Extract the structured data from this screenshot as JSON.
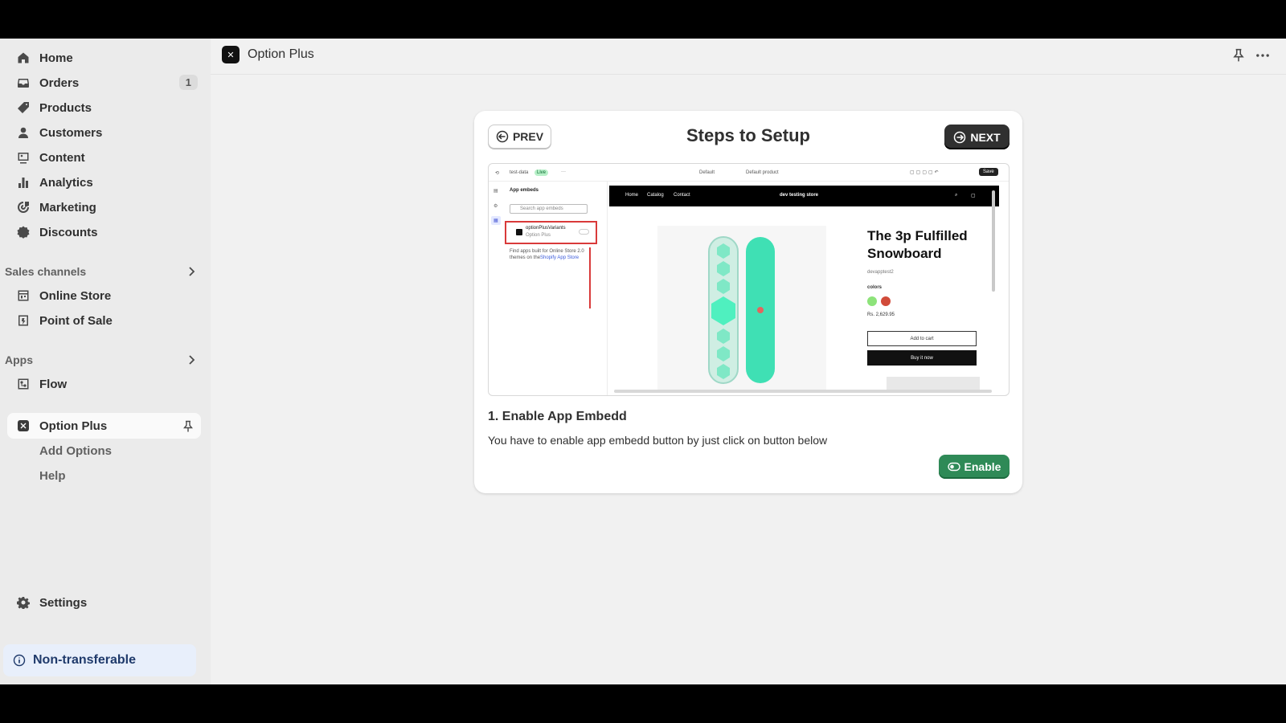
{
  "sidebar": {
    "items": [
      {
        "label": "Home",
        "icon": "home-icon"
      },
      {
        "label": "Orders",
        "icon": "inbox-icon",
        "badge": "1"
      },
      {
        "label": "Products",
        "icon": "tag-icon"
      },
      {
        "label": "Customers",
        "icon": "person-icon"
      },
      {
        "label": "Content",
        "icon": "image-icon"
      },
      {
        "label": "Analytics",
        "icon": "bar-chart-icon"
      },
      {
        "label": "Marketing",
        "icon": "target-icon"
      },
      {
        "label": "Discounts",
        "icon": "discount-icon"
      }
    ],
    "sales_channels_label": "Sales channels",
    "sales_channels": [
      {
        "label": "Online Store",
        "icon": "store-icon"
      },
      {
        "label": "Point of Sale",
        "icon": "pos-icon"
      }
    ],
    "apps_label": "Apps",
    "apps": [
      {
        "label": "Flow",
        "icon": "flow-icon"
      }
    ],
    "active_app": {
      "label": "Option Plus",
      "sub_items": [
        "Add Options",
        "Help"
      ]
    },
    "settings_label": "Settings",
    "non_transferable_label": "Non-transferable"
  },
  "topbar": {
    "app_title": "Option Plus"
  },
  "card": {
    "title": "Steps to Setup",
    "prev_label": "PREV",
    "next_label": "NEXT",
    "step_title": "1. Enable App Embedd",
    "step_description": "You have to enable app embedd button by just click on button below",
    "enable_label": "Enable"
  },
  "preview": {
    "theme_name": "test-data",
    "live_badge": "Live",
    "default_label": "Default",
    "default_product_label": "Default product",
    "save_label": "Save",
    "app_embeds_label": "App embeds",
    "search_placeholder": "Search app embeds",
    "embed_name": "optionPlusVariants",
    "embed_app": "Option Plus",
    "find_apps_text": "Find apps built for Online Store 2.0",
    "find_apps_text2": "themes on the",
    "app_store_link": "Shopify App Store",
    "nav": [
      "Home",
      "Catalog",
      "Contact"
    ],
    "store_name": "dev testing store",
    "product_title": "The 3p Fulfilled Snowboard",
    "vendor": "devapptest2",
    "colors_label": "colors",
    "price": "Rs. 2,629.95",
    "add_to_cart": "Add to cart",
    "buy_now": "Buy it now"
  },
  "colors": {
    "accent_green": "#2f8a57",
    "dark_button": "#303030",
    "highlight_red": "#d93a3a"
  }
}
